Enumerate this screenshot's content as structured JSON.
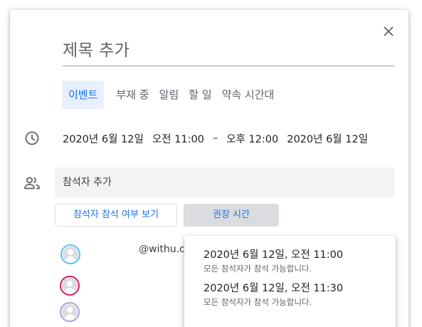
{
  "title_placeholder": "제목 추가",
  "tabs": [
    {
      "label": "이벤트",
      "active": true
    },
    {
      "label": "부재 중",
      "active": false
    },
    {
      "label": "알림",
      "active": false
    },
    {
      "label": "할 일",
      "active": false
    },
    {
      "label": "약속 시간대",
      "active": false
    }
  ],
  "datetime": {
    "start_date": "2020년 6월 12일",
    "start_time": "오전 11:00",
    "separator": "–",
    "end_time": "오후 12:00",
    "end_date": "2020년 6월 12일"
  },
  "guests": {
    "placeholder": "참석자 추가",
    "view_rsvp_label": "참석자 참석 여부 보기",
    "suggested_times_label": "권장 시간",
    "email_fragment": "@withu.c"
  },
  "suggestions": [
    {
      "time": "2020년 6월 12일, 오전 11:00",
      "note": "모든 참석자가 참석 가능합니다."
    },
    {
      "time": "2020년 6월 12일, 오전 11:30",
      "note": "모든 참석자가 참석 가능합니다."
    }
  ],
  "colors": {
    "accent": "#1a73e8",
    "active_tab_bg": "#e8f0fe",
    "avatar_ring_1": "#4fc3f7",
    "avatar_ring_2": "#d81b60",
    "avatar_ring_3": "#b39ddb"
  },
  "icons": [
    "close-icon",
    "clock-icon",
    "people-icon",
    "avatar-icon"
  ]
}
